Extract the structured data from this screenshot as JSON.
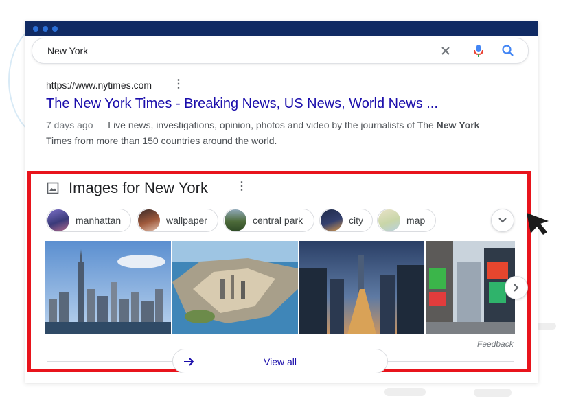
{
  "search": {
    "query": "New York"
  },
  "result": {
    "url": "https://www.nytimes.com",
    "title": "The New York Times - Breaking News, US News, World News ...",
    "date": "7 days ago",
    "snippet_part1": " — Live news, investigations, opinion, photos and video by the journalists of The ",
    "snippet_bold1": "New",
    "snippet_bold2": "York",
    "snippet_part2": " Times from more than 150 countries around the world."
  },
  "images": {
    "title": "Images for New York",
    "chips": [
      "manhattan",
      "wallpaper",
      "central park",
      "city",
      "map"
    ],
    "feedback": "Feedback",
    "view_all": "View all"
  },
  "colors": {
    "titlebar": "#102a63",
    "link": "#1a0dab",
    "highlight": "#e8141c",
    "mic_blue": "#4285f4",
    "mic_red": "#ea4335"
  },
  "icons": [
    "clear-icon",
    "mic-icon",
    "search-icon",
    "image-icon",
    "chevron-down-icon",
    "chevron-right-icon",
    "arrow-right-icon",
    "mouse-cursor-icon"
  ]
}
